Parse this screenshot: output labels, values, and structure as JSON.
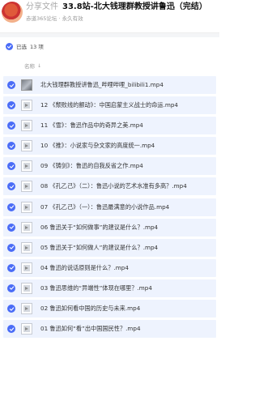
{
  "header": {
    "share_label": "分享文件",
    "title": "33.8站-北大钱理群教授讲鲁迅（完结）",
    "source": "赤道365论坛",
    "validity": "永久有效",
    "separator": "·"
  },
  "selection": {
    "label": "已选",
    "count": "13 项"
  },
  "column": {
    "name": "名称",
    "sort_arrow": "↓"
  },
  "files": [
    {
      "name": "北大钱理群教授讲鲁迅_哔哩哔哩_bilibili1.mp4",
      "thumb": "photo"
    },
    {
      "name": "12 《颓败线的颤动》：中国启蒙主义战士的命运.mp4",
      "thumb": "video"
    },
    {
      "name": "11 《雪》：鲁迅作品中的奇异之美.mp4",
      "thumb": "video"
    },
    {
      "name": "10 《推》：小说家与杂文家的高度统一.mp4",
      "thumb": "video"
    },
    {
      "name": "09 《铸剑》：鲁迅的自我反省之作.mp4",
      "thumb": "video"
    },
    {
      "name": "08 《孔乙己》（二）：鲁迅小说的艺术水准有多高？.mp4",
      "thumb": "video"
    },
    {
      "name": "07 《孔乙己》（一）：鲁迅最满意的小说作品.mp4",
      "thumb": "video"
    },
    {
      "name": "06 鲁迅关于“如何做事”的建议是什么？.mp4",
      "thumb": "video"
    },
    {
      "name": "05 鲁迅关于“如何做人”的建议是什么？.mp4",
      "thumb": "video"
    },
    {
      "name": "04 鲁迅的说话原则是什么？.mp4",
      "thumb": "video"
    },
    {
      "name": "03 鲁迅思维的“异端性”体现在哪里？.mp4",
      "thumb": "video"
    },
    {
      "name": "02 鲁迅如何看中国的历史与未来.mp4",
      "thumb": "video"
    },
    {
      "name": "01 鲁迅如何“看”出中国国民性？.mp4",
      "thumb": "video"
    }
  ],
  "colors": {
    "accent": "#4a6cf7",
    "row_selected": "#eef3fe"
  }
}
